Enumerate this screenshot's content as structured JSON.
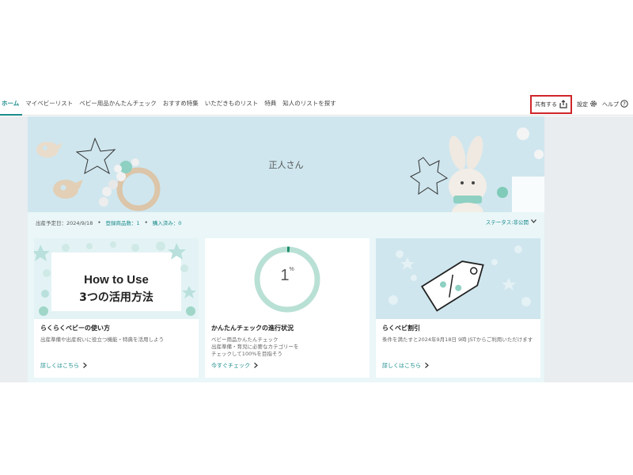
{
  "nav": {
    "tabs": [
      "ホーム",
      "マイベビーリスト",
      "ベビー用品かんたんチェック",
      "おすすめ特集",
      "いただきものリスト",
      "特典",
      "知人のリストを探す"
    ],
    "share_label": "共有する",
    "settings_label": "設定",
    "help_label": "ヘルプ"
  },
  "banner": {
    "name": "正人さん"
  },
  "info": {
    "due_date": "出産予定日：2024/9/18",
    "registered": "登録商品数：1",
    "purchased": "購入済み：0",
    "status": "ステータス:非公開"
  },
  "cards": [
    {
      "image_line1": "How to Use",
      "image_line2": "3つの活用方法",
      "title": "らくらくベビーの使い方",
      "desc": "出産準備や出産祝いに役立つ機能・特典を活用しよう",
      "link": "詳しくはこちら"
    },
    {
      "progress_value": "1",
      "progress_unit": "%",
      "progress_fraction": 0.01,
      "title": "かんたんチェックの進行状況",
      "desc_lines": [
        "ベビー用品かんたんチェック",
        "出産準備・育児に必要なカテゴリーを",
        "チェックして100%を目指そう"
      ],
      "link": "今すぐチェック"
    },
    {
      "title": "らくベビ割引",
      "desc": "条件を満たすと2024年9月18日 9時 JSTからご利用いただけます",
      "link": "詳しくはこちら"
    }
  ],
  "colors": {
    "accent": "#1a8a8a",
    "highlight": "#d0262a",
    "banner": "#cfe6ee",
    "mint": "#9fd6c8"
  }
}
